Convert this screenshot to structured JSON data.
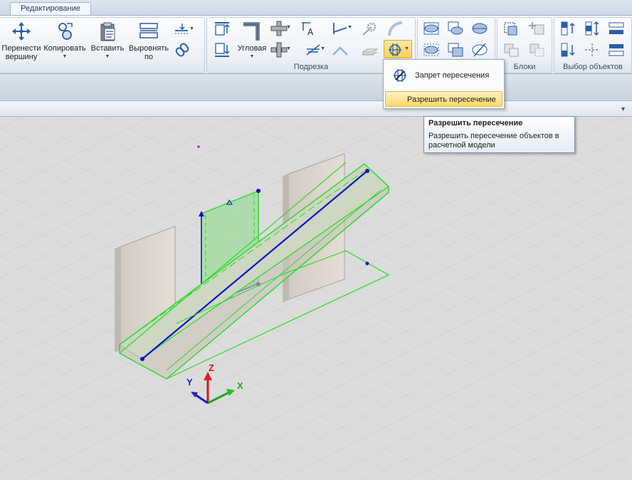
{
  "tabs": [
    {
      "label": "Редактирование",
      "active": true
    }
  ],
  "ribbon": {
    "edit_group": {
      "buttons": [
        {
          "label_line1": "Перенести",
          "label_line2": "вершину",
          "icon": "move-vertex-icon",
          "has_dropdown": false
        },
        {
          "label_line1": "Копировать",
          "label_line2": "",
          "icon": "copy-icon",
          "has_dropdown": true
        },
        {
          "label_line1": "Вставить",
          "label_line2": "",
          "icon": "paste-icon",
          "has_dropdown": true
        },
        {
          "label_line1": "Выровнять",
          "label_line2": "по",
          "icon": "align-icon",
          "has_dropdown": false
        }
      ]
    },
    "trim_group": {
      "label": "Подрезка",
      "angular_label": "Угловая"
    },
    "blocks_group": {
      "label": "Блоки"
    },
    "select_group": {
      "label": "Выбор объектов"
    }
  },
  "menu": {
    "items": [
      {
        "label": "Запрет пересечения",
        "icon": "forbid-intersection-icon",
        "highlighted": false
      },
      {
        "label": "Разрешить пересечение",
        "icon": "",
        "highlighted": true
      }
    ]
  },
  "tooltip": {
    "title": "Разрешить пересечение",
    "body_line1": "Разрешить пересечение объектов в",
    "body_line2": "расчетной модели"
  },
  "axes": {
    "x": "X",
    "y": "Y",
    "z": "Z"
  },
  "colors": {
    "selection_green": "#22dd22",
    "axis_blue": "#1010c8",
    "ribbon_bg": "#e9eef4",
    "highlight": "#fbd968"
  }
}
